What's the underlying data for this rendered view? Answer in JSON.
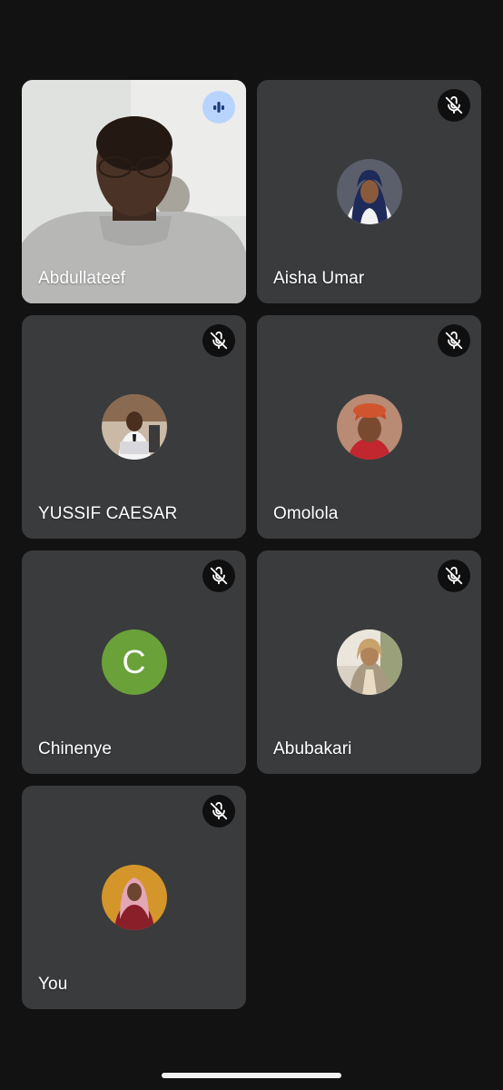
{
  "participants": [
    {
      "name": "Abdullateef",
      "state": "speaking",
      "video": true
    },
    {
      "name": "Aisha Umar",
      "state": "muted",
      "avatar": "photo"
    },
    {
      "name": "YUSSIF CAESAR",
      "state": "muted",
      "avatar": "photo"
    },
    {
      "name": "Omolola",
      "state": "muted",
      "avatar": "photo"
    },
    {
      "name": "Chinenye",
      "state": "muted",
      "avatar": "letter",
      "letter": "C",
      "avatar_color": "#6aa139"
    },
    {
      "name": "Abubakari",
      "state": "muted",
      "avatar": "photo"
    },
    {
      "name": "You",
      "state": "muted",
      "avatar": "photo"
    }
  ],
  "icons": {
    "muted": "mic-off-icon",
    "speaking": "audio-level-icon"
  },
  "colors": {
    "background": "#121212",
    "tile": "#3a3b3d",
    "speaking_badge": "#b9d3ff",
    "speaking_glyph": "#1a3e7a"
  }
}
